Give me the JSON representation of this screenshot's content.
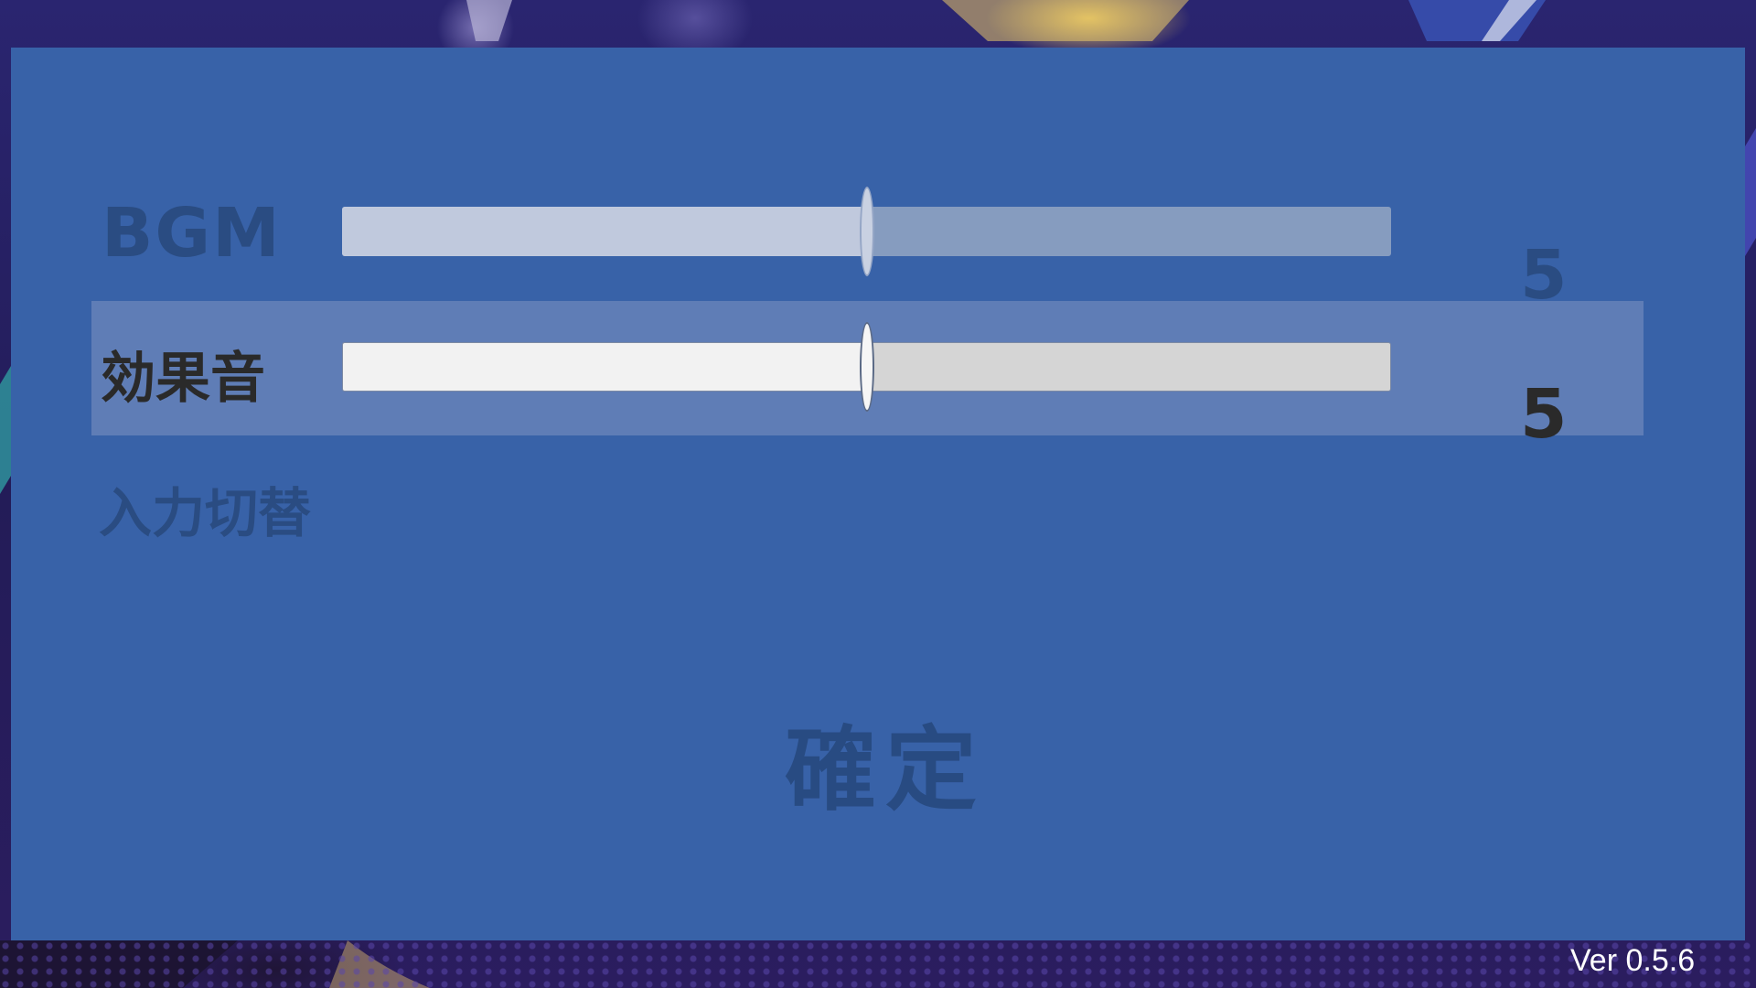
{
  "settings": {
    "bgm": {
      "label": "BGM",
      "value": "5",
      "level": 0.5,
      "selected": false
    },
    "se": {
      "label": "効果音",
      "value": "5",
      "level": 0.5,
      "selected": true
    },
    "input_switch": {
      "label": "入力切替"
    },
    "confirm_label": "確定"
  },
  "version": "Ver 0.5.6",
  "colors": {
    "panel": "#3862a8",
    "selected_row": "#5f7db6",
    "inactive_text": "#2a4c82",
    "active_text": "#2a2a2a"
  },
  "icons": {
    "slider_thumb": "ellipse-handle"
  }
}
